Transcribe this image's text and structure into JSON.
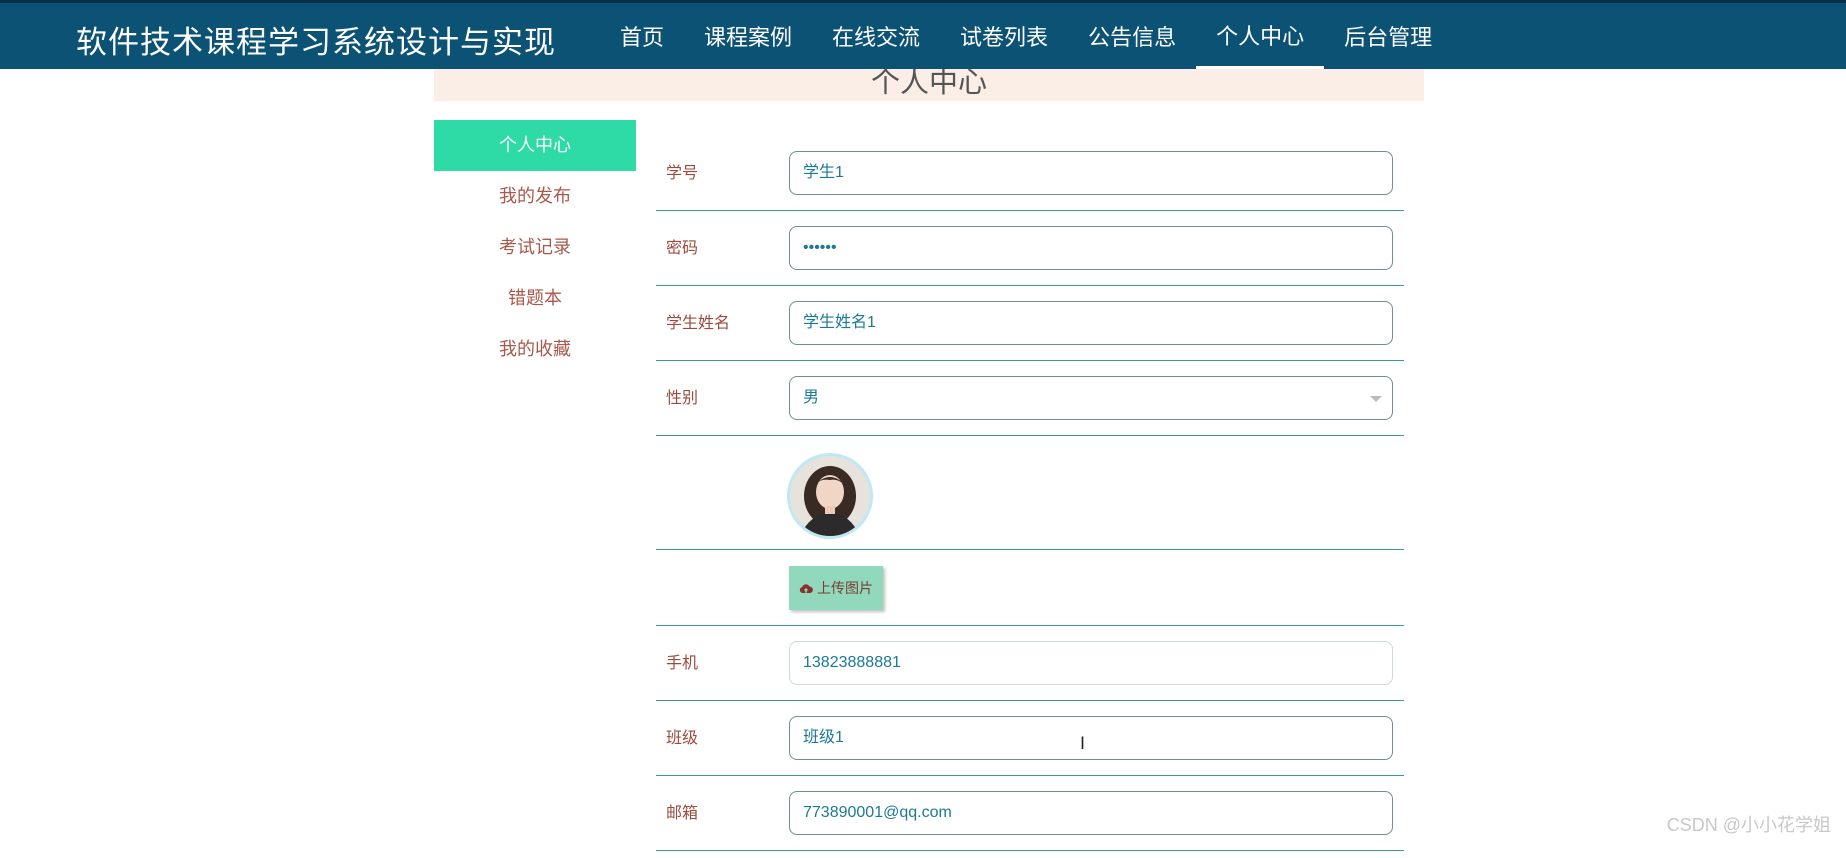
{
  "site": {
    "title": "软件技术课程学习系统设计与实现"
  },
  "nav": {
    "items": [
      "首页",
      "课程案例",
      "在线交流",
      "试卷列表",
      "公告信息",
      "个人中心",
      "后台管理"
    ],
    "active": "个人中心"
  },
  "page": {
    "banner_title": "个人中心"
  },
  "sidebar": {
    "items": [
      {
        "label": "个人中心"
      },
      {
        "label": "我的发布"
      },
      {
        "label": "考试记录"
      },
      {
        "label": "错题本"
      },
      {
        "label": "我的收藏"
      }
    ],
    "active": "个人中心"
  },
  "form": {
    "student_id": {
      "label": "学号",
      "value": "学生1"
    },
    "password": {
      "label": "密码",
      "value": "••••••"
    },
    "student_name": {
      "label": "学生姓名",
      "value": "学生姓名1"
    },
    "gender": {
      "label": "性别",
      "value": "男"
    },
    "upload_label": "上传图片",
    "phone": {
      "label": "手机",
      "value": "13823888881"
    },
    "class": {
      "label": "班级",
      "value": "班级1"
    },
    "email": {
      "label": "邮箱",
      "value": "773890001@qq.com"
    }
  },
  "watermark": "CSDN @小小花学姐",
  "colors": {
    "nav_bg": "#0b5275",
    "sidebar_active_bg": "#2edba6",
    "banner_bg": "#fbeee6",
    "label_text": "#9b4c3e",
    "input_text": "#1b7a96",
    "row_divider": "#3a9a98",
    "upload_btn_bg": "#91d8bd"
  },
  "icons": {
    "upload": "cloud-upload-icon",
    "select": "chevron-down-icon",
    "cursor": "text-cursor-icon"
  }
}
